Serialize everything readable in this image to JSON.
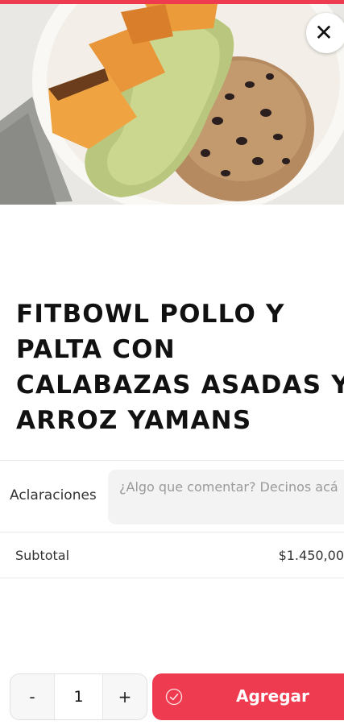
{
  "header": {
    "close_icon": "close-icon",
    "accent_color": "#ee3b4f"
  },
  "product": {
    "title": "FITBOWL POLLO Y\nPALTA CON\nCALABAZAS ASADAS Y\nARROZ YAMANS",
    "image": "food-bowl-photo"
  },
  "notes": {
    "label": "Aclaraciones",
    "placeholder": "¿Algo que comentar? Decinos acá",
    "value": ""
  },
  "summary": {
    "subtotal_label": "Subtotal",
    "subtotal_value": "$1.450,00"
  },
  "footer": {
    "decrement_label": "-",
    "quantity": "1",
    "increment_label": "+",
    "add_label": "Agregar",
    "add_icon": "check-circle-icon"
  }
}
